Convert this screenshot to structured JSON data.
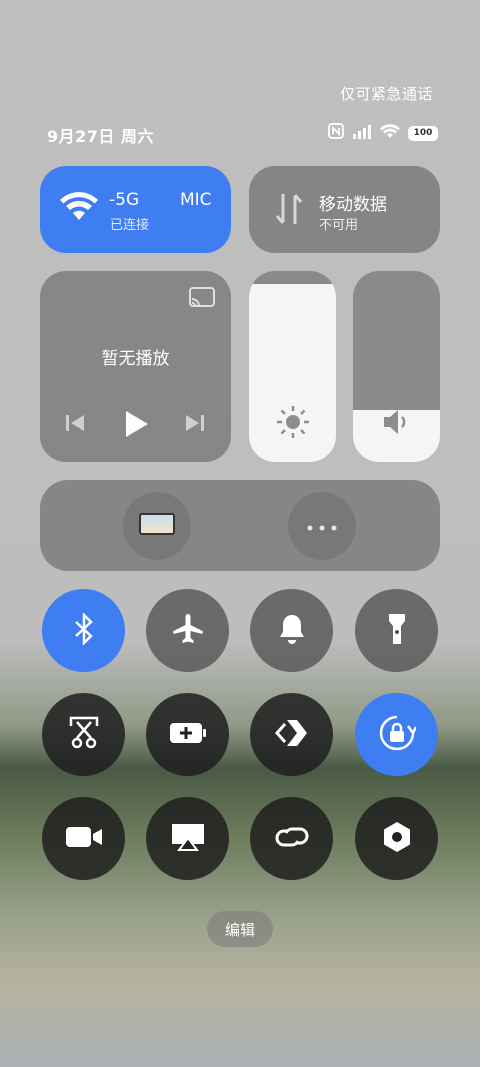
{
  "header": {
    "emergency_text": "仅可紧急通话",
    "date_text": "9月27日 周六",
    "battery_text": "100"
  },
  "wifi": {
    "title": "-5G",
    "suffix": "MIC",
    "status": "已连接",
    "active": true
  },
  "mobile_data": {
    "title": "移动数据",
    "status": "不可用",
    "active": false
  },
  "media": {
    "text": "暂无播放"
  },
  "sliders": {
    "brightness_level": 0.93,
    "volume_level": 0.27
  },
  "toggles": [
    {
      "name": "bluetooth",
      "on": true
    },
    {
      "name": "airplane",
      "on": false
    },
    {
      "name": "ring",
      "on": false
    },
    {
      "name": "flashlight",
      "on": false
    },
    {
      "name": "screenshot",
      "on": false
    },
    {
      "name": "battery-saver",
      "on": false
    },
    {
      "name": "shortcut",
      "on": false
    },
    {
      "name": "rotation-lock",
      "on": true
    },
    {
      "name": "screen-record",
      "on": false
    },
    {
      "name": "cast",
      "on": false
    },
    {
      "name": "link",
      "on": false
    },
    {
      "name": "settings",
      "on": false
    }
  ],
  "edit_label": "编辑",
  "colors": {
    "accent": "#3f7df2"
  }
}
